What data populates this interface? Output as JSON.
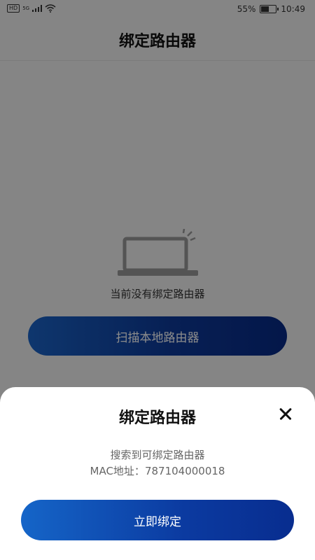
{
  "statusbar": {
    "network_badge": "HD",
    "signal_label": "5G",
    "battery_percent_text": "55%",
    "battery_level": 0.55,
    "time": "10:49"
  },
  "header": {
    "title": "绑定路由器"
  },
  "empty_state": {
    "message": "当前没有绑定路由器",
    "illustration_icon": "laptop-icon"
  },
  "scan_button_label": "扫描本地路由器",
  "sheet": {
    "title": "绑定路由器",
    "close_icon": "close-icon",
    "found_text": "搜索到可绑定路由器",
    "mac_label": "MAC地址：",
    "mac_value": "787104000018",
    "bind_button_label": "立即绑定"
  },
  "colors": {
    "primary_dark": "#082a86",
    "primary_light": "#1b64c8",
    "overlay": "rgba(0,0,0,0.45)"
  }
}
